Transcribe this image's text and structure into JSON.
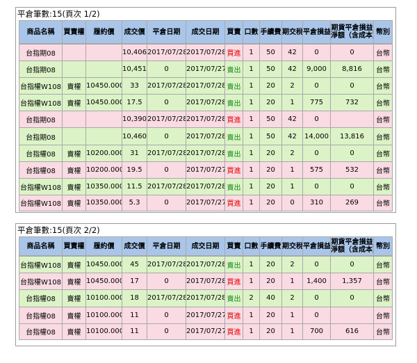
{
  "columns": [
    "商品名稱",
    "買賣權",
    "履約價",
    "成交價",
    "平倉日期",
    "成交日期",
    "買賣",
    "口數",
    "手續費",
    "期交稅",
    "平倉損益",
    "期貨平倉損益淨額（含成本）",
    "幣別"
  ],
  "colors": {
    "header": "#a9c6ea",
    "buy_row": "#fadbe3",
    "sell_row": "#dcf3c7",
    "buy_text": "#e20000",
    "sell_text": "#1a8a1a"
  },
  "panels": [
    {
      "title": "平倉筆數:15(頁次 1/2)",
      "header_wrap": {
        "line1": "期貨平倉損益",
        "line2": "淨額（含成本）"
      },
      "rows": [
        {
          "type": "buy",
          "cells": [
            "台指期08",
            "",
            "",
            "10,406",
            "2017/07/28",
            "2017/07/28",
            "買進",
            "1",
            "50",
            "42",
            "0",
            "0",
            "台幣"
          ]
        },
        {
          "type": "sell",
          "cells": [
            "台指期08",
            "",
            "",
            "10,451",
            "0",
            "2017/07/27",
            "賣出",
            "1",
            "50",
            "42",
            "9,000",
            "8,816",
            "台幣"
          ]
        },
        {
          "type": "sell",
          "cells": [
            "台指權W108",
            "賣權",
            "10450.000",
            "33",
            "2017/07/28",
            "2017/07/28",
            "賣出",
            "1",
            "20",
            "2",
            "0",
            "0",
            "台幣"
          ]
        },
        {
          "type": "sell",
          "cells": [
            "台指權W108",
            "賣權",
            "10450.000",
            "17.5",
            "0",
            "2017/07/28",
            "賣出",
            "1",
            "20",
            "1",
            "775",
            "732",
            "台幣"
          ]
        },
        {
          "type": "buy",
          "cells": [
            "台指期08",
            "",
            "",
            "10,390",
            "2017/07/28",
            "2017/07/28",
            "買進",
            "1",
            "50",
            "42",
            "0",
            "",
            "台幣"
          ]
        },
        {
          "type": "sell",
          "cells": [
            "台指期08",
            "",
            "",
            "10,460",
            "0",
            "2017/07/28",
            "賣出",
            "1",
            "50",
            "42",
            "14,000",
            "13,816",
            "台幣"
          ]
        },
        {
          "type": "sell",
          "cells": [
            "台指權08",
            "賣權",
            "10200.000",
            "31",
            "2017/07/28",
            "2017/07/28",
            "賣出",
            "1",
            "20",
            "2",
            "0",
            "0",
            "台幣"
          ]
        },
        {
          "type": "buy",
          "cells": [
            "台指權08",
            "賣權",
            "10200.000",
            "19.5",
            "0",
            "2017/07/27",
            "買進",
            "1",
            "20",
            "1",
            "575",
            "532",
            "台幣"
          ]
        },
        {
          "type": "sell",
          "cells": [
            "台指權W108",
            "賣權",
            "10350.000",
            "11.5",
            "2017/07/28",
            "2017/07/28",
            "賣出",
            "1",
            "20",
            "1",
            "0",
            "0",
            "台幣"
          ]
        },
        {
          "type": "buy",
          "cells": [
            "台指權W108",
            "賣權",
            "10350.000",
            "5.3",
            "0",
            "2017/07/27",
            "買進",
            "1",
            "20",
            "0",
            "310",
            "269",
            "台幣"
          ]
        }
      ]
    },
    {
      "title": "平倉筆數:15(頁次 2/2)",
      "header_wrap": {
        "line1": "期貨平倉損益",
        "line2": "淨額（含成本）"
      },
      "rows": [
        {
          "type": "sell",
          "cells": [
            "台指權W108",
            "賣權",
            "10450.000",
            "45",
            "2017/07/28",
            "2017/07/28",
            "賣出",
            "1",
            "20",
            "2",
            "0",
            "0",
            "台幣"
          ]
        },
        {
          "type": "buy",
          "cells": [
            "台指權W108",
            "賣權",
            "10450.000",
            "17",
            "0",
            "2017/07/28",
            "買進",
            "1",
            "20",
            "1",
            "1,400",
            "1,357",
            "台幣"
          ]
        },
        {
          "type": "sell",
          "cells": [
            "台指權08",
            "賣權",
            "10100.000",
            "18",
            "2017/07/28",
            "2017/07/28",
            "賣出",
            "2",
            "40",
            "2",
            "0",
            "0",
            "台幣"
          ]
        },
        {
          "type": "buy",
          "cells": [
            "台指權08",
            "賣權",
            "10100.000",
            "11",
            "0",
            "2017/07/27",
            "買進",
            "1",
            "20",
            "1",
            "0",
            "",
            "台幣"
          ]
        },
        {
          "type": "buy",
          "cells": [
            "台指權08",
            "賣權",
            "10100.000",
            "11",
            "0",
            "2017/07/27",
            "買進",
            "1",
            "20",
            "1",
            "700",
            "616",
            "台幣"
          ]
        }
      ]
    }
  ]
}
